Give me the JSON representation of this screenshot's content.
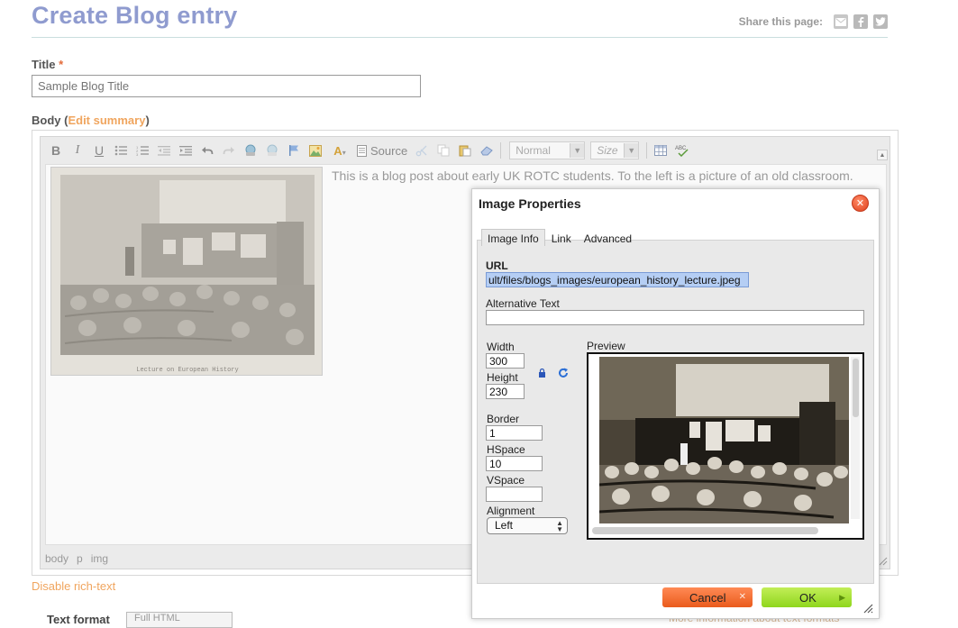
{
  "header": {
    "title": "Create Blog entry",
    "share_label": "Share this page:",
    "share_icons": [
      "email-icon",
      "facebook-icon",
      "twitter-icon"
    ]
  },
  "form": {
    "title_label": "Title",
    "title_required": "*",
    "title_placeholder": "Sample Blog Title",
    "body_label": "Body (",
    "edit_summary": "Edit summary",
    "body_label_end": ")"
  },
  "toolbar": {
    "source_label": "Source",
    "format_combo": "Normal",
    "size_combo": "Size"
  },
  "editor": {
    "post_text": "This is a blog post about early UK ROTC students. To the left is a picture of an old classroom.",
    "image_caption": "Lecture on European History",
    "path": [
      "body",
      "p",
      "img"
    ]
  },
  "below_editor": {
    "disable_rich_text": "Disable rich-text",
    "text_format_label": "Text format",
    "text_format_value": "Full HTML",
    "more_info": "More information about text formats"
  },
  "dialog": {
    "title": "Image Properties",
    "tabs": [
      "Image Info",
      "Link",
      "Advanced"
    ],
    "active_tab": "Image Info",
    "url_label": "URL",
    "url_value": "ult/files/blogs_images/european_history_lecture.jpeg",
    "alt_label": "Alternative Text",
    "alt_value": "",
    "width_label": "Width",
    "width_value": "300",
    "height_label": "Height",
    "height_value": "230",
    "border_label": "Border",
    "border_value": "1",
    "hspace_label": "HSpace",
    "hspace_value": "10",
    "vspace_label": "VSpace",
    "vspace_value": "",
    "alignment_label": "Alignment",
    "alignment_value": "Left",
    "preview_label": "Preview",
    "cancel_label": "Cancel",
    "ok_label": "OK"
  },
  "colors": {
    "title": "#8f9bcf",
    "link": "#f0a55e",
    "required": "#e36b3b",
    "cancel": "#ea5b1c",
    "ok": "#8fd61d",
    "close": "#e0401c",
    "url_selection": "#b5cef4"
  }
}
